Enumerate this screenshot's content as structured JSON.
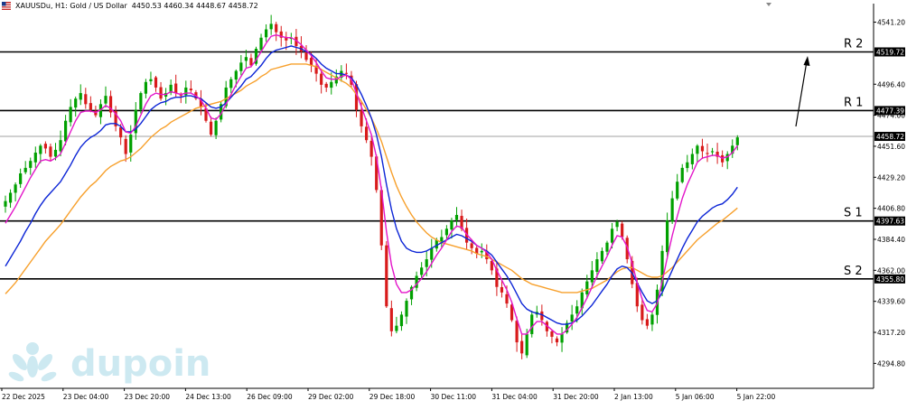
{
  "header": {
    "symbol": "XAUUSDu, H1:  Gold / US Dollar",
    "ohlc": "4450.53 4460.34 4448.67 4458.72",
    "icon": "flag-icon"
  },
  "watermark": {
    "brand": "dupoin",
    "icon": "dupoin-logo-icon"
  },
  "colors": {
    "up": "#00a000",
    "down": "#d81b1b",
    "ema_fast": "#e316c9",
    "ema_mid": "#0c25d6",
    "ema_slow": "#f7a02c",
    "level": "#000000",
    "price_line": "#a0a0a0",
    "watermark": "#cde9f1"
  },
  "chart_data": {
    "type": "candlestick",
    "symbol": "XAUUSDu",
    "timeframe": "H1",
    "ylim": [
      4282,
      4552
    ],
    "y_ticks": [
      "4541.20",
      "4519.72",
      "4496.40",
      "4474.00",
      "4451.60",
      "4429.20",
      "4406.80",
      "4384.40",
      "4362.00",
      "4339.60",
      "4317.20",
      "4294.80"
    ],
    "x_ticks": [
      "22 Dec 2025",
      "23 Dec 04:00",
      "23 Dec 20:00",
      "24 Dec 13:00",
      "26 Dec 09:00",
      "29 Dec 02:00",
      "29 Dec 18:00",
      "30 Dec 11:00",
      "31 Dec 04:00",
      "31 Dec 20:00",
      "2 Jan 13:00",
      "5 Jan 06:00",
      "5 Jan 22:00"
    ],
    "levels": [
      {
        "name": "R 2",
        "value": 4519.72,
        "label": "4519.72"
      },
      {
        "name": "R 1",
        "value": 4477.39,
        "label": "4477.39"
      },
      {
        "name": "S 1",
        "value": 4397.63,
        "label": "4397.63"
      },
      {
        "name": "S 2",
        "value": 4355.8,
        "label": "4355.80"
      }
    ],
    "current_price": {
      "value": 4458.72,
      "label": "4458.72"
    },
    "close_path": [
      4412,
      4418,
      4424,
      4432,
      4436,
      4441,
      4447,
      4452,
      4450,
      4444,
      4449,
      4456,
      4470,
      4480,
      4486,
      4490,
      4482,
      4478,
      4474,
      4482,
      4488,
      4476,
      4466,
      4458,
      4446,
      4460,
      4478,
      4490,
      4498,
      4500,
      4494,
      4486,
      4490,
      4496,
      4490,
      4488,
      4494,
      4492,
      4486,
      4480,
      4470,
      4460,
      4470,
      4482,
      4494,
      4500,
      4506,
      4512,
      4516,
      4510,
      4522,
      4530,
      4536,
      4540,
      4534,
      4530,
      4528,
      4530,
      4524,
      4520,
      4514,
      4510,
      4504,
      4496,
      4494,
      4498,
      4502,
      4506,
      4504,
      4496,
      4478,
      4466,
      4456,
      4444,
      4420,
      4380,
      4336,
      4318,
      4322,
      4330,
      4340,
      4350,
      4358,
      4364,
      4370,
      4378,
      4384,
      4386,
      4392,
      4398,
      4402,
      4392,
      4382,
      4378,
      4374,
      4376,
      4370,
      4362,
      4350,
      4346,
      4338,
      4326,
      4310,
      4302,
      4316,
      4330,
      4332,
      4326,
      4318,
      4314,
      4310,
      4316,
      4324,
      4330,
      4336,
      4346,
      4354,
      4362,
      4370,
      4376,
      4382,
      4392,
      4397,
      4386,
      4370,
      4352,
      4336,
      4326,
      4322,
      4330,
      4348,
      4376,
      4398,
      4414,
      4426,
      4436,
      4440,
      4446,
      4452,
      4448,
      4446,
      4448,
      4444,
      4440,
      4446,
      4452,
      4458
    ],
    "ema_fast_path": [
      4396,
      4402,
      4408,
      4415,
      4422,
      4429,
      4435,
      4441,
      4442,
      4441,
      4443,
      4446,
      4454,
      4462,
      4470,
      4476,
      4477,
      4477,
      4476,
      4478,
      4481,
      4479,
      4475,
      4470,
      4462,
      4461,
      4466,
      4474,
      4482,
      4488,
      4490,
      4489,
      4489,
      4491,
      4490,
      4489,
      4490,
      4490,
      4488,
      4485,
      4479,
      4472,
      4471,
      4475,
      4482,
      4489,
      4496,
      4502,
      4508,
      4509,
      4514,
      4520,
      4526,
      4531,
      4532,
      4531,
      4530,
      4530,
      4528,
      4525,
      4521,
      4517,
      4512,
      4506,
      4501,
      4500,
      4500,
      4502,
      4503,
      4500,
      4490,
      4480,
      4470,
      4460,
      4444,
      4420,
      4390,
      4366,
      4352,
      4346,
      4346,
      4348,
      4352,
      4356,
      4361,
      4367,
      4373,
      4378,
      4384,
      4390,
      4394,
      4393,
      4388,
      4384,
      4380,
      4378,
      4375,
      4370,
      4362,
      4355,
      4348,
      4339,
      4327,
      4316,
      4316,
      4321,
      4325,
      4325,
      4322,
      4319,
      4316,
      4316,
      4319,
      4323,
      4328,
      4335,
      4342,
      4350,
      4358,
      4365,
      4372,
      4380,
      4387,
      4386,
      4379,
      4367,
      4353,
      4341,
      4333,
      4332,
      4338,
      4354,
      4371,
      4387,
      4401,
      4414,
      4424,
      4432,
      4440,
      4443,
      4444,
      4445,
      4445,
      4443,
      4444,
      4447,
      4452
    ],
    "ema_mid_path": [
      4365,
      4371,
      4377,
      4383,
      4390,
      4396,
      4403,
      4409,
      4414,
      4418,
      4422,
      4426,
      4432,
      4438,
      4445,
      4451,
      4455,
      4458,
      4460,
      4463,
      4467,
      4468,
      4468,
      4466,
      4462,
      4462,
      4464,
      4468,
      4473,
      4478,
      4481,
      4483,
      4484,
      4486,
      4487,
      4487,
      4488,
      4488,
      4487,
      4486,
      4483,
      4480,
      4479,
      4480,
      4483,
      4487,
      4491,
      4495,
      4500,
      4502,
      4506,
      4510,
      4515,
      4519,
      4521,
      4522,
      4523,
      4524,
      4523,
      4522,
      4520,
      4518,
      4515,
      4511,
      4508,
      4506,
      4504,
      4504,
      4503,
      4501,
      4496,
      4489,
      4481,
      4472,
      4460,
      4444,
      4424,
      4406,
      4392,
      4383,
      4378,
      4376,
      4375,
      4375,
      4376,
      4378,
      4380,
      4382,
      4384,
      4386,
      4388,
      4387,
      4385,
      4383,
      4380,
      4378,
      4376,
      4373,
      4368,
      4363,
      4358,
      4352,
      4345,
      4338,
      4334,
      4332,
      4331,
      4330,
      4328,
      4326,
      4324,
      4323,
      4323,
      4324,
      4326,
      4329,
      4333,
      4337,
      4342,
      4347,
      4352,
      4358,
      4363,
      4365,
      4364,
      4360,
      4353,
      4346,
      4340,
      4338,
      4340,
      4346,
      4354,
      4362,
      4370,
      4378,
      4385,
      4391,
      4397,
      4401,
      4404,
      4407,
      4409,
      4410,
      4413,
      4417,
      4422
    ],
    "ema_slow_path": [
      4345,
      4349,
      4353,
      4358,
      4363,
      4368,
      4373,
      4378,
      4383,
      4387,
      4391,
      4395,
      4400,
      4405,
      4410,
      4415,
      4419,
      4423,
      4426,
      4430,
      4434,
      4437,
      4439,
      4441,
      4442,
      4444,
      4447,
      4450,
      4454,
      4458,
      4461,
      4464,
      4466,
      4469,
      4471,
      4473,
      4475,
      4477,
      4479,
      4480,
      4481,
      4482,
      4483,
      4484,
      4486,
      4488,
      4490,
      4492,
      4495,
      4497,
      4499,
      4502,
      4504,
      4507,
      4508,
      4509,
      4510,
      4511,
      4511,
      4511,
      4511,
      4510,
      4509,
      4507,
      4505,
      4503,
      4501,
      4499,
      4497,
      4494,
      4489,
      4484,
      4478,
      4472,
      4464,
      4455,
      4444,
      4433,
      4423,
      4415,
      4408,
      4402,
      4397,
      4393,
      4389,
      4386,
      4384,
      4382,
      4381,
      4380,
      4379,
      4378,
      4377,
      4376,
      4374,
      4373,
      4372,
      4370,
      4368,
      4366,
      4364,
      4362,
      4359,
      4356,
      4354,
      4352,
      4351,
      4350,
      4349,
      4348,
      4347,
      4346,
      4346,
      4346,
      4346,
      4347,
      4348,
      4349,
      4351,
      4353,
      4355,
      4358,
      4361,
      4363,
      4364,
      4364,
      4362,
      4360,
      4358,
      4357,
      4357,
      4358,
      4361,
      4364,
      4368,
      4372,
      4376,
      4380,
      4384,
      4387,
      4390,
      4393,
      4396,
      4398,
      4401,
      4404,
      4407
    ]
  },
  "annotations": {
    "arrow": "up-arrow"
  }
}
